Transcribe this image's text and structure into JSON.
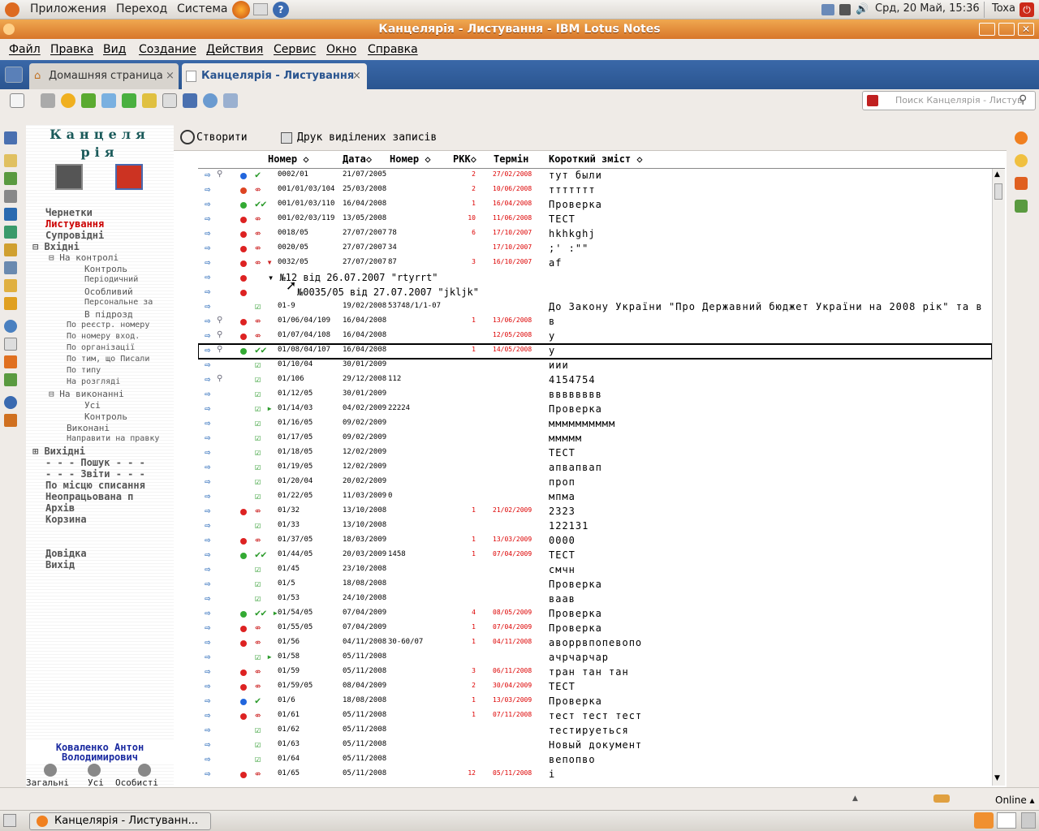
{
  "panel": {
    "menus": [
      "Приложения",
      "Переход",
      "Система"
    ],
    "datetime": "Срд, 20 Май, 15:36",
    "user": "Toxa"
  },
  "window": {
    "title": "Канцелярія - Листування - IBM Lotus Notes"
  },
  "menu": [
    "Файл",
    "Правка",
    "Вид",
    "Создание",
    "Действия",
    "Сервис",
    "Окно",
    "Справка"
  ],
  "tabs": [
    {
      "label": "Домашняя страница"
    },
    {
      "label": "Канцелярія - Листування"
    }
  ],
  "search": {
    "placeholder": "Поиск Канцелярія - Листув"
  },
  "nav": {
    "title1": "Канцеля",
    "title2": "рія",
    "items": [
      "Чернетки",
      "Листування",
      "Супровідні",
      "Вхідні",
      "На контролі",
      "Контроль",
      "Періодичний",
      "Особливий",
      "Персональне за",
      "В підрозд",
      "По реєстр. номеру",
      "По номеру вход.",
      "По організації",
      "По тим, що Писали",
      "По типу",
      "На розгляді",
      "На виконанні",
      "Усі",
      "Контроль",
      "Виконані",
      "Направити на правку",
      "Вихідні",
      "- - - Пошук - - -",
      "- - - Звіти - - -",
      "По місцю списання",
      "Неопрацьована п",
      "Архів",
      "Корзина",
      "Довідка",
      "Вихід"
    ],
    "user_line1": "Коваленко Антон",
    "user_line2": "Володимирович",
    "bottom": [
      "Загальні",
      "Усі",
      "Особисті"
    ]
  },
  "actions": {
    "create": "Створити",
    "print": "Друк виділених записів"
  },
  "columns": [
    "Номер",
    "Дата",
    "Номер",
    "РКК",
    "Термін",
    "Короткий зміст"
  ],
  "rows": [
    {
      "a": "⇨",
      "clip": "⚲",
      "dot": "#2266dd",
      "st": "✔",
      "stc": "#2a9a2a",
      "num": "0002/01",
      "dat": "21/07/2005",
      "nom": "",
      "rkk": "2",
      "ter": "27/02/2008",
      "sum": "тут были"
    },
    {
      "a": "⇨",
      "clip": "",
      "dot": "#dd4422",
      "st": "⇎",
      "stc": "#cc2222",
      "num": "001/01/03/104",
      "dat": "25/03/2008",
      "nom": "",
      "rkk": "2",
      "ter": "10/06/2008",
      "sum": "ттттттт"
    },
    {
      "a": "⇨",
      "clip": "",
      "dot": "#33aa33",
      "st": "✔✔",
      "stc": "#2a9a2a",
      "num": "001/01/03/110",
      "dat": "16/04/2008",
      "nom": "",
      "rkk": "1",
      "ter": "16/04/2008",
      "sum": "Проверка"
    },
    {
      "a": "⇨",
      "clip": "",
      "dot": "#dd2222",
      "st": "⇎",
      "stc": "#cc2222",
      "num": "001/02/03/119",
      "dat": "13/05/2008",
      "nom": "",
      "rkk": "10",
      "ter": "11/06/2008",
      "sum": "ТЕСТ"
    },
    {
      "a": "⇨",
      "clip": "",
      "dot": "#dd2222",
      "st": "⇎",
      "stc": "#cc2222",
      "num": "0018/05",
      "dat": "27/07/2007",
      "nom": "78",
      "rkk": "6",
      "ter": "17/10/2007",
      "sum": "hkhkghj"
    },
    {
      "a": "⇨",
      "clip": "",
      "dot": "#dd2222",
      "st": "⇎",
      "stc": "#cc2222",
      "num": "0020/05",
      "dat": "27/07/2007",
      "nom": "34",
      "rkk": "",
      "ter": "17/10/2007",
      "sum": ";' :\"\""
    },
    {
      "a": "⇨",
      "clip": "",
      "dot": "#dd2222",
      "st": "⇎ ▾",
      "stc": "#cc2222",
      "num": "0032/05",
      "dat": "27/07/2007",
      "nom": "87",
      "rkk": "3",
      "ter": "16/10/2007",
      "sum": "af"
    },
    {
      "a": "⇨",
      "clip": "",
      "dot": "#dd2222",
      "st": "",
      "stc": "#000",
      "num": "",
      "dat": "",
      "nom": "",
      "rkk": "",
      "ter": "",
      "sum": "",
      "special": "▾ №12  від  26.07.2007 \"rtyrrt\""
    },
    {
      "a": "⇨",
      "clip": "",
      "dot": "#dd2222",
      "st": "",
      "stc": "#000",
      "num": "",
      "dat": "",
      "nom": "",
      "rkk": "",
      "ter": "",
      "sum": "",
      "special2": "№0035/05  від  27.07.2007 \"jkljk\""
    },
    {
      "a": "⇨",
      "clip": "",
      "dot": "",
      "st": "☑",
      "stc": "#2a9a2a",
      "num": "01-9",
      "dat": "19/02/2008",
      "nom": "53748/1/1-07",
      "rkk": "",
      "ter": "",
      "sum": "До Закону України \"Про Державний бюджет України на 2008 рік\" та в"
    },
    {
      "a": "⇨",
      "clip": "⚲",
      "dot": "#dd2222",
      "st": "⇎",
      "stc": "#cc2222",
      "num": "01/06/04/109",
      "dat": "16/04/2008",
      "nom": "",
      "rkk": "1",
      "ter": "13/06/2008",
      "sum": "в"
    },
    {
      "a": "⇨",
      "clip": "⚲",
      "dot": "#dd2222",
      "st": "⇎",
      "stc": "#cc2222",
      "num": "01/07/04/108",
      "dat": "16/04/2008",
      "nom": "",
      "rkk": "",
      "ter": "12/05/2008",
      "sum": "у"
    },
    {
      "a": "⇨",
      "clip": "⚲",
      "dot": "#33aa33",
      "st": "✔✔",
      "stc": "#2a9a2a",
      "num": "01/08/04/107",
      "dat": "16/04/2008",
      "nom": "",
      "rkk": "1",
      "ter": "14/05/2008",
      "sum": "у",
      "sel": true
    },
    {
      "a": "⇨",
      "clip": "",
      "dot": "",
      "st": "☑",
      "stc": "#2a9a2a",
      "num": "01/10/04",
      "dat": "30/01/2009",
      "nom": "",
      "rkk": "",
      "ter": "",
      "sum": "иии"
    },
    {
      "a": "⇨",
      "clip": "⚲",
      "dot": "",
      "st": "☑",
      "stc": "#2a9a2a",
      "num": "01/106",
      "dat": "29/12/2008",
      "nom": "112",
      "rkk": "",
      "ter": "",
      "sum": "4154754"
    },
    {
      "a": "⇨",
      "clip": "",
      "dot": "",
      "st": "☑",
      "stc": "#2a9a2a",
      "num": "01/12/05",
      "dat": "30/01/2009",
      "nom": "",
      "rkk": "",
      "ter": "",
      "sum": "вввввввв"
    },
    {
      "a": "⇨",
      "clip": "",
      "dot": "",
      "st": "☑ ▸",
      "stc": "#2a9a2a",
      "num": "01/14/03",
      "dat": "04/02/2009",
      "nom": "22224",
      "rkk": "",
      "ter": "",
      "sum": "Проверка"
    },
    {
      "a": "⇨",
      "clip": "",
      "dot": "",
      "st": "☑",
      "stc": "#2a9a2a",
      "num": "01/16/05",
      "dat": "09/02/2009",
      "nom": "",
      "rkk": "",
      "ter": "",
      "sum": "мммммммммм"
    },
    {
      "a": "⇨",
      "clip": "",
      "dot": "",
      "st": "☑",
      "stc": "#2a9a2a",
      "num": "01/17/05",
      "dat": "09/02/2009",
      "nom": "",
      "rkk": "",
      "ter": "",
      "sum": "ммммм"
    },
    {
      "a": "⇨",
      "clip": "",
      "dot": "",
      "st": "☑",
      "stc": "#2a9a2a",
      "num": "01/18/05",
      "dat": "12/02/2009",
      "nom": "",
      "rkk": "",
      "ter": "",
      "sum": "ТЕСТ"
    },
    {
      "a": "⇨",
      "clip": "",
      "dot": "",
      "st": "☑",
      "stc": "#2a9a2a",
      "num": "01/19/05",
      "dat": "12/02/2009",
      "nom": "",
      "rkk": "",
      "ter": "",
      "sum": "апвапвап"
    },
    {
      "a": "⇨",
      "clip": "",
      "dot": "",
      "st": "☑",
      "stc": "#2a9a2a",
      "num": "01/20/04",
      "dat": "20/02/2009",
      "nom": "",
      "rkk": "",
      "ter": "",
      "sum": "проп"
    },
    {
      "a": "⇨",
      "clip": "",
      "dot": "",
      "st": "☑",
      "stc": "#2a9a2a",
      "num": "01/22/05",
      "dat": "11/03/2009",
      "nom": "0",
      "rkk": "",
      "ter": "",
      "sum": "мпма"
    },
    {
      "a": "⇨",
      "clip": "",
      "dot": "#dd2222",
      "st": "⇎",
      "stc": "#cc2222",
      "num": "01/32",
      "dat": "13/10/2008",
      "nom": "",
      "rkk": "1",
      "ter": "21/02/2009",
      "sum": "2323"
    },
    {
      "a": "⇨",
      "clip": "",
      "dot": "",
      "st": "☑",
      "stc": "#2a9a2a",
      "num": "01/33",
      "dat": "13/10/2008",
      "nom": "",
      "rkk": "",
      "ter": "",
      "sum": "122131"
    },
    {
      "a": "⇨",
      "clip": "",
      "dot": "#dd2222",
      "st": "⇎",
      "stc": "#cc2222",
      "num": "01/37/05",
      "dat": "18/03/2009",
      "nom": "",
      "rkk": "1",
      "ter": "13/03/2009",
      "sum": "0000"
    },
    {
      "a": "⇨",
      "clip": "",
      "dot": "#33aa33",
      "st": "✔✔",
      "stc": "#2a9a2a",
      "num": "01/44/05",
      "dat": "20/03/2009",
      "nom": "1458",
      "rkk": "1",
      "ter": "07/04/2009",
      "sum": "ТЕСТ"
    },
    {
      "a": "⇨",
      "clip": "",
      "dot": "",
      "st": "☑",
      "stc": "#2a9a2a",
      "num": "01/45",
      "dat": "23/10/2008",
      "nom": "",
      "rkk": "",
      "ter": "",
      "sum": "смчн"
    },
    {
      "a": "⇨",
      "clip": "",
      "dot": "",
      "st": "☑",
      "stc": "#2a9a2a",
      "num": "01/5",
      "dat": "18/08/2008",
      "nom": "",
      "rkk": "",
      "ter": "",
      "sum": "Проверка"
    },
    {
      "a": "⇨",
      "clip": "",
      "dot": "",
      "st": "☑",
      "stc": "#2a9a2a",
      "num": "01/53",
      "dat": "24/10/2008",
      "nom": "",
      "rkk": "",
      "ter": "",
      "sum": "ваав"
    },
    {
      "a": "⇨",
      "clip": "",
      "dot": "#33aa33",
      "st": "✔✔ ▸",
      "stc": "#2a9a2a",
      "num": "01/54/05",
      "dat": "07/04/2009",
      "nom": "",
      "rkk": "4",
      "ter": "08/05/2009",
      "sum": "Проверка"
    },
    {
      "a": "⇨",
      "clip": "",
      "dot": "#dd2222",
      "st": "⇎",
      "stc": "#cc2222",
      "num": "01/55/05",
      "dat": "07/04/2009",
      "nom": "",
      "rkk": "1",
      "ter": "07/04/2009",
      "sum": "Проверка"
    },
    {
      "a": "⇨",
      "clip": "",
      "dot": "#dd2222",
      "st": "⇎",
      "stc": "#cc2222",
      "num": "01/56",
      "dat": "04/11/2008",
      "nom": "30-60/07",
      "rkk": "1",
      "ter": "04/11/2008",
      "sum": "аворрвпопевопо"
    },
    {
      "a": "⇨",
      "clip": "",
      "dot": "",
      "st": "☑ ▸",
      "stc": "#2a9a2a",
      "num": "01/58",
      "dat": "05/11/2008",
      "nom": "",
      "rkk": "",
      "ter": "",
      "sum": "ачрчарчар"
    },
    {
      "a": "⇨",
      "clip": "",
      "dot": "#dd2222",
      "st": "⇎",
      "stc": "#cc2222",
      "num": "01/59",
      "dat": "05/11/2008",
      "nom": "",
      "rkk": "3",
      "ter": "06/11/2008",
      "sum": "тран тан тан"
    },
    {
      "a": "⇨",
      "clip": "",
      "dot": "#dd2222",
      "st": "⇎",
      "stc": "#cc2222",
      "num": "01/59/05",
      "dat": "08/04/2009",
      "nom": "",
      "rkk": "2",
      "ter": "30/04/2009",
      "sum": "ТЕСТ"
    },
    {
      "a": "⇨",
      "clip": "",
      "dot": "#2266dd",
      "st": "✔",
      "stc": "#2a9a2a",
      "num": "01/6",
      "dat": "18/08/2008",
      "nom": "",
      "rkk": "1",
      "ter": "13/03/2009",
      "sum": "Проверка"
    },
    {
      "a": "⇨",
      "clip": "",
      "dot": "#dd2222",
      "st": "⇎",
      "stc": "#cc2222",
      "num": "01/61",
      "dat": "05/11/2008",
      "nom": "",
      "rkk": "1",
      "ter": "07/11/2008",
      "sum": "тест тест тест"
    },
    {
      "a": "⇨",
      "clip": "",
      "dot": "",
      "st": "☑",
      "stc": "#2a9a2a",
      "num": "01/62",
      "dat": "05/11/2008",
      "nom": "",
      "rkk": "",
      "ter": "",
      "sum": "тестируеться"
    },
    {
      "a": "⇨",
      "clip": "",
      "dot": "",
      "st": "☑",
      "stc": "#2a9a2a",
      "num": "01/63",
      "dat": "05/11/2008",
      "nom": "",
      "rkk": "",
      "ter": "",
      "sum": "Новый документ"
    },
    {
      "a": "⇨",
      "clip": "",
      "dot": "",
      "st": "☑",
      "stc": "#2a9a2a",
      "num": "01/64",
      "dat": "05/11/2008",
      "nom": "",
      "rkk": "",
      "ter": "",
      "sum": "вепопво"
    },
    {
      "a": "⇨",
      "clip": "",
      "dot": "#dd2222",
      "st": "⇎",
      "stc": "#cc2222",
      "num": "01/65",
      "dat": "05/11/2008",
      "nom": "",
      "rkk": "12",
      "ter": "05/11/2008",
      "sum": "і"
    }
  ],
  "status": {
    "online": "Online"
  },
  "taskbar": {
    "item": "Канцелярія - Листуванн..."
  }
}
